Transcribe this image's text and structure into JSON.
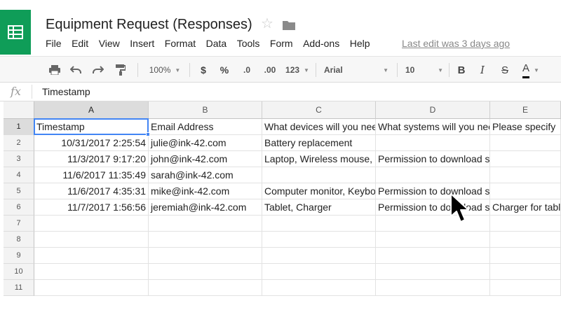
{
  "header": {
    "title": "Equipment Request (Responses)",
    "last_edit": "Last edit was 3 days ago",
    "menu": [
      "File",
      "Edit",
      "View",
      "Insert",
      "Format",
      "Data",
      "Tools",
      "Form",
      "Add-ons",
      "Help"
    ]
  },
  "toolbar": {
    "zoom": "100%",
    "currency": "$",
    "percent": "%",
    "decrease_decimal": ".0",
    "increase_decimal": ".00",
    "more_formats": "123",
    "font": "Arial",
    "font_size": "10",
    "bold": "B",
    "italic": "I",
    "strikethrough": "S",
    "text_color": "A"
  },
  "formula_bar": {
    "label": "fx",
    "content": "Timestamp"
  },
  "sheet": {
    "columns": [
      "A",
      "B",
      "C",
      "D",
      "E"
    ],
    "row_numbers": [
      "1",
      "2",
      "3",
      "4",
      "5",
      "6",
      "7",
      "8",
      "9",
      "10",
      "11"
    ],
    "rows": [
      [
        "Timestamp",
        "Email Address",
        "What devices will you need",
        "What systems will you need",
        "Please specify"
      ],
      [
        "10/31/2017 2:25:54",
        "julie@ink-42.com",
        "Battery replacement",
        "",
        ""
      ],
      [
        "11/3/2017 9:17:20",
        "john@ink-42.com",
        "Laptop, Wireless mouse, ",
        "Permission to download software, Google",
        ""
      ],
      [
        "11/6/2017 11:35:49",
        "sarah@ink-42.com",
        "",
        "",
        ""
      ],
      [
        "11/6/2017 4:35:31",
        "mike@ink-42.com",
        "Computer monitor, Keyboard",
        "Permission to download software, Google",
        ""
      ],
      [
        "11/7/2017 1:56:56",
        "jeremiah@ink-42.com",
        "Tablet, Charger",
        "Permission to download s",
        "Charger for tablet"
      ],
      [
        "",
        "",
        "",
        "",
        ""
      ],
      [
        "",
        "",
        "",
        "",
        ""
      ],
      [
        "",
        "",
        "",
        "",
        ""
      ],
      [
        "",
        "",
        "",
        "",
        ""
      ],
      [
        "",
        "",
        "",
        "",
        ""
      ]
    ],
    "selected_cell": "A1"
  },
  "colors": {
    "brand_green": "#0f9d58",
    "selection_blue": "#4285f4"
  },
  "icons": [
    "sheets-logo-icon",
    "star-icon",
    "folder-icon",
    "print-icon",
    "undo-icon",
    "redo-icon",
    "paint-format-icon",
    "text-color-icon",
    "mouse-pointer-icon"
  ]
}
